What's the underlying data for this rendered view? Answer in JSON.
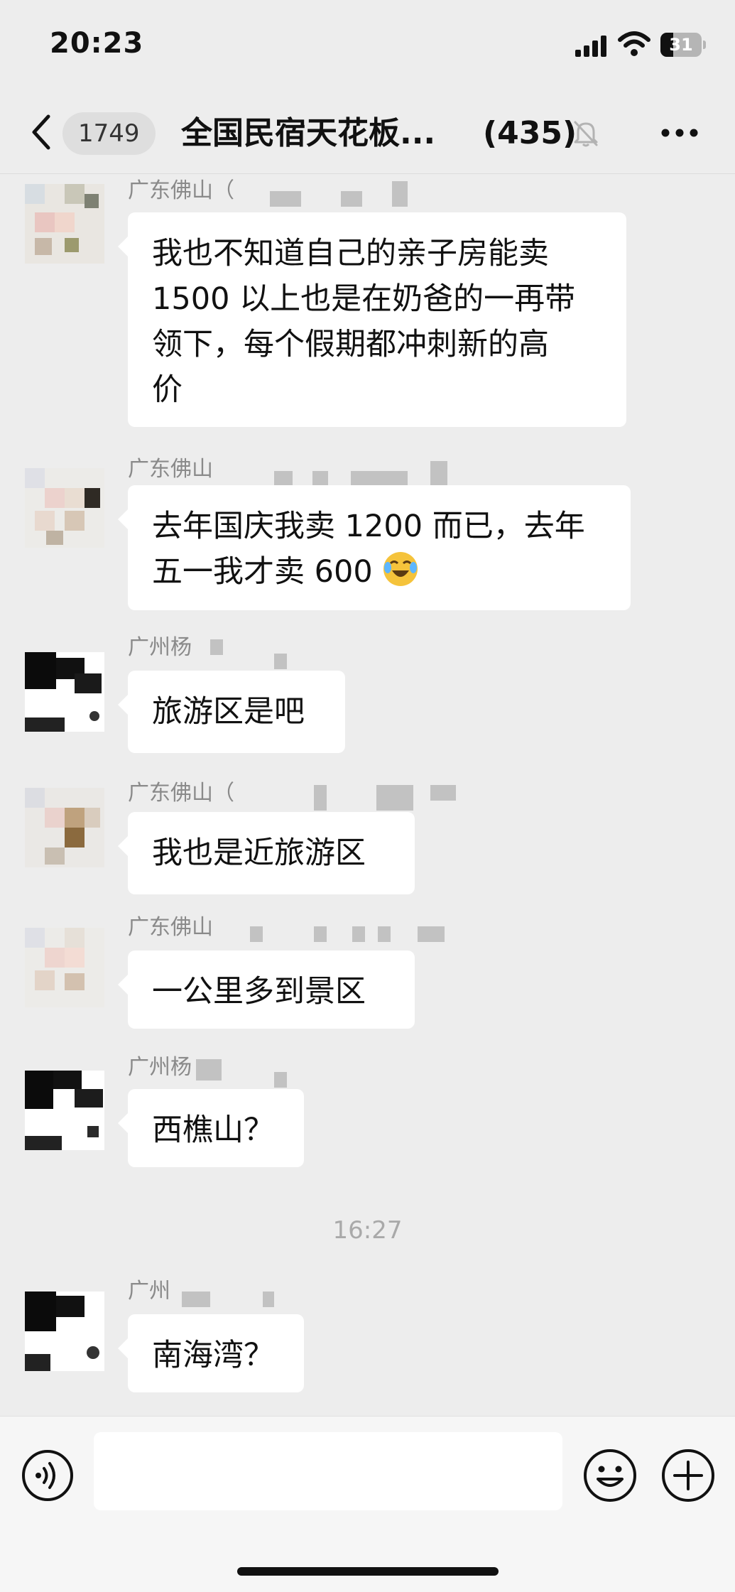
{
  "status_bar": {
    "time": "20:23",
    "battery_level": "31",
    "icons": [
      "signal-icon",
      "wifi-icon",
      "battery-icon"
    ]
  },
  "header": {
    "unread_count": "1749",
    "title": "全国民宿天花板...",
    "member_count": "(435)",
    "icons": [
      "back-icon",
      "mute-bell-icon",
      "more-icon"
    ]
  },
  "messages": [
    {
      "sender": "广东佛山（",
      "lines": [
        "我也不知道自己的亲子房能卖",
        "1500 以上也是在奶爸的一再带",
        "领下，每个假期都冲刺新的高",
        "价"
      ]
    },
    {
      "sender": "广东佛山",
      "lines": [
        "去年国庆我卖 1200 而已，去年",
        "五一我才卖 600"
      ],
      "emoji": "crying-laughing-emoji"
    },
    {
      "sender": "广州杨",
      "lines": [
        "旅游区是吧"
      ]
    },
    {
      "sender": "广东佛山（",
      "lines": [
        "我也是近旅游区"
      ]
    },
    {
      "sender": "广东佛山",
      "lines": [
        "一公里多到景区"
      ]
    },
    {
      "sender": "广州杨",
      "lines": [
        "西樵山？"
      ]
    },
    {
      "sender": "广州",
      "lines": [
        "南海湾？"
      ]
    }
  ],
  "time_divider": "16:27",
  "input_bar": {
    "placeholder": "",
    "icons": [
      "voice-icon",
      "emoji-icon",
      "plus-icon"
    ]
  },
  "colors": {
    "background": "#ededed",
    "bubble": "#ffffff",
    "sender_name": "#8a8a8a",
    "time_divider": "#a9a9a9"
  }
}
